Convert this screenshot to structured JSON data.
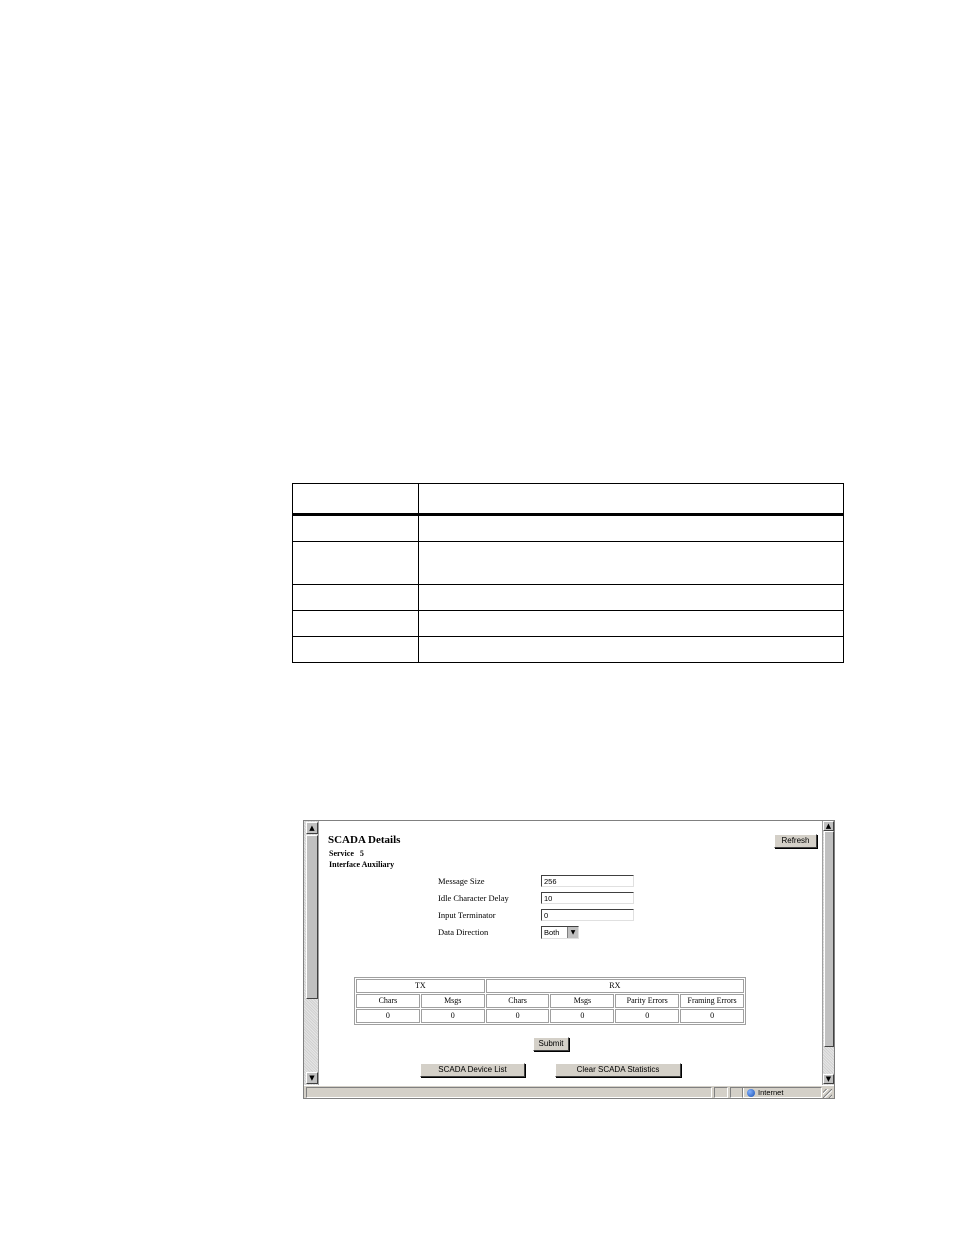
{
  "window": {
    "title": "SCADA Details",
    "service_label": "Service",
    "service_value": "5",
    "interface_label": "Interface",
    "interface_value": "Auxiliary",
    "refresh_label": "Refresh"
  },
  "form": {
    "message_size_label": "Message Size",
    "message_size_value": "256",
    "idle_delay_label": "Idle Character Delay",
    "idle_delay_value": "10",
    "input_terminator_label": "Input Terminator",
    "input_terminator_value": "0",
    "data_direction_label": "Data Direction",
    "data_direction_value": "Both"
  },
  "stats": {
    "tx_label": "TX",
    "rx_label": "RX",
    "columns": [
      "Chars",
      "Msgs",
      "Chars",
      "Msgs",
      "Parity Errors",
      "Framing Errors"
    ],
    "values": [
      "0",
      "0",
      "0",
      "0",
      "0",
      "0"
    ]
  },
  "buttons": {
    "submit": "Submit",
    "device_list": "SCADA Device List",
    "clear_stats": "Clear SCADA Statistics"
  },
  "status": {
    "zone": "Internet"
  }
}
